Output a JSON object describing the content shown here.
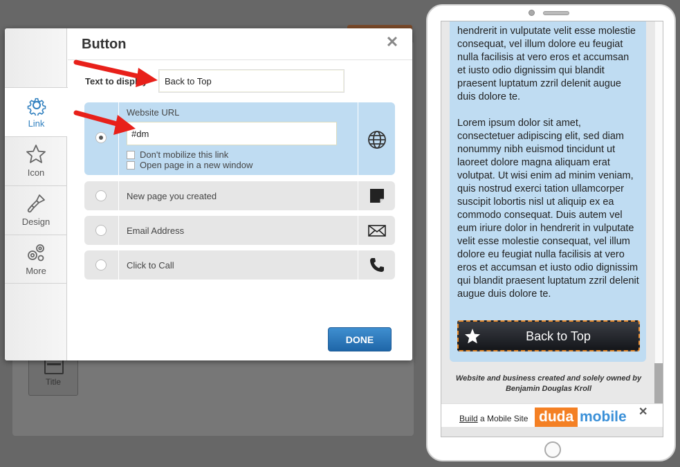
{
  "modal": {
    "title": "Button",
    "close_glyph": "✕",
    "tabs": [
      {
        "label": "Link",
        "icon": "gear-icon",
        "active": true
      },
      {
        "label": "Icon",
        "icon": "star-icon",
        "active": false
      },
      {
        "label": "Design",
        "icon": "paintbrush-icon",
        "active": false
      },
      {
        "label": "More",
        "icon": "gears-icon",
        "active": false
      }
    ],
    "text_to_display_label": "Text to display",
    "text_to_display_value": "Back to Top",
    "options": {
      "website_url": {
        "label": "Website URL",
        "value": "#dm",
        "checkbox_no_mobilize": "Don't mobilize this link",
        "checkbox_new_window": "Open page in a new window",
        "icon": "globe-icon"
      },
      "new_page": {
        "label": "New page you created",
        "icon": "page-icon"
      },
      "email": {
        "label": "Email Address",
        "icon": "envelope-icon"
      },
      "call": {
        "label": "Click to Call",
        "icon": "phone-icon"
      }
    },
    "done_label": "DONE"
  },
  "background": {
    "title_tile_label": "Title"
  },
  "phone_preview": {
    "paragraph_1": "hendrerit in vulputate velit esse molestie consequat, vel illum dolore eu feugiat nulla facilisis at vero eros et accumsan et iusto odio dignissim qui blandit praesent luptatum zzril delenit augue duis dolore te.",
    "paragraph_2": "Lorem ipsum dolor sit amet, consectetuer adipiscing elit, sed diam nonummy nibh euismod tincidunt ut laoreet dolore magna aliquam erat volutpat. Ut wisi enim ad minim veniam, quis nostrud exerci tation ullamcorper suscipit lobortis nisl ut aliquip ex ea commodo consequat. Duis autem vel eum iriure dolor in hendrerit in vulputate velit esse molestie consequat, vel illum dolore eu feugiat nulla facilisis at vero eros et accumsan et iusto odio dignissim qui blandit praesent luptatum zzril delenit augue duis dolore te.",
    "button_label": "Back to Top",
    "footer_text": "Website and business created and solely owned by Benjamin Douglas Kroll",
    "promo_build": "Build",
    "promo_rest": " a Mobile Site",
    "promo_logo_duda": "duda",
    "promo_logo_mobile": "mobile",
    "promo_close": "✕"
  },
  "colors": {
    "accent_blue": "#2f7fbf",
    "selected_row": "#bfdcf2",
    "done_button": "#1f66a8",
    "arrow_red": "#e8201a",
    "duda_orange": "#f48024"
  }
}
